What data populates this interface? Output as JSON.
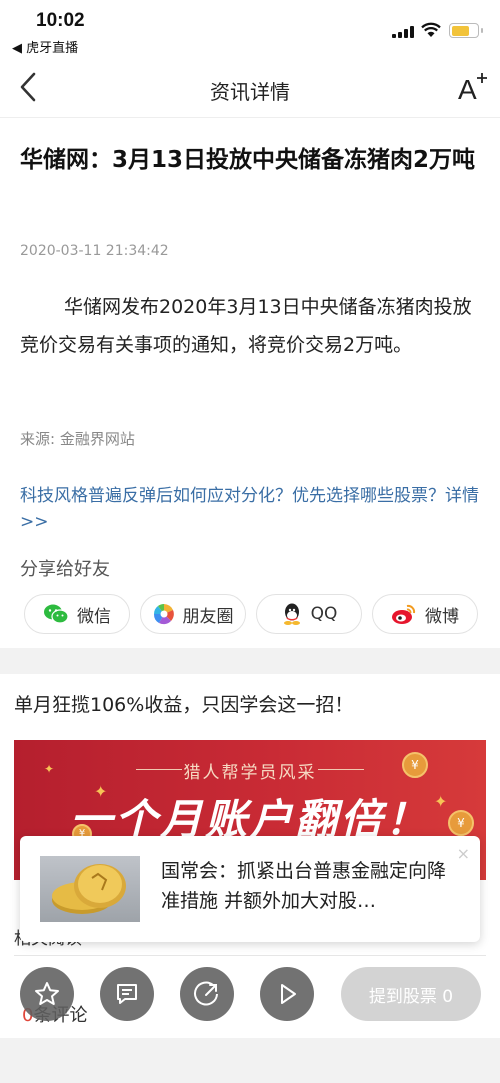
{
  "status_bar": {
    "time": "10:02",
    "back_app": "◀ 虎牙直播"
  },
  "nav": {
    "title": "资讯详情",
    "font_button": "A"
  },
  "article": {
    "title": "华储网：3月13日投放中央储备冻猪肉2万吨",
    "date": "2020-03-11 21:34:42",
    "body": "华储网发布2020年3月13日中央储备冻猪肉投放竞价交易有关事项的通知，将竞价交易2万吨。",
    "source": "来源: 金融界网站"
  },
  "promo_link": "科技风格普遍反弹后如何应对分化？优先选择哪些股票？详情>>",
  "share": {
    "title": "分享给好友",
    "buttons": [
      {
        "label": "微信",
        "icon": "wechat-icon"
      },
      {
        "label": "朋友圈",
        "icon": "moments-icon"
      },
      {
        "label": "QQ",
        "icon": "qq-icon"
      },
      {
        "label": "微博",
        "icon": "weibo-icon"
      }
    ]
  },
  "ad": {
    "heading": "单月狂揽106%收益，只因学会这一招！",
    "banner_sub": "猎人帮学员风采",
    "banner_main": "一个月账户翻倍！"
  },
  "news_popup": {
    "text": "国常会：抓紧出台普惠金融定向降准措施 并额外加大对股…",
    "close": "×"
  },
  "related_label": "相关阅读",
  "comments": {
    "count": "0",
    "suffix": "条评论"
  },
  "action_bar": {
    "stock_button": "提到股票 0",
    "buttons": [
      "star-icon",
      "comment-icon",
      "share-icon",
      "play-icon"
    ]
  },
  "colors": {
    "link": "#3a6ea5",
    "banner_red": "#c92b35",
    "comment_count": "#e0463a",
    "battery": "#f2c33a"
  }
}
